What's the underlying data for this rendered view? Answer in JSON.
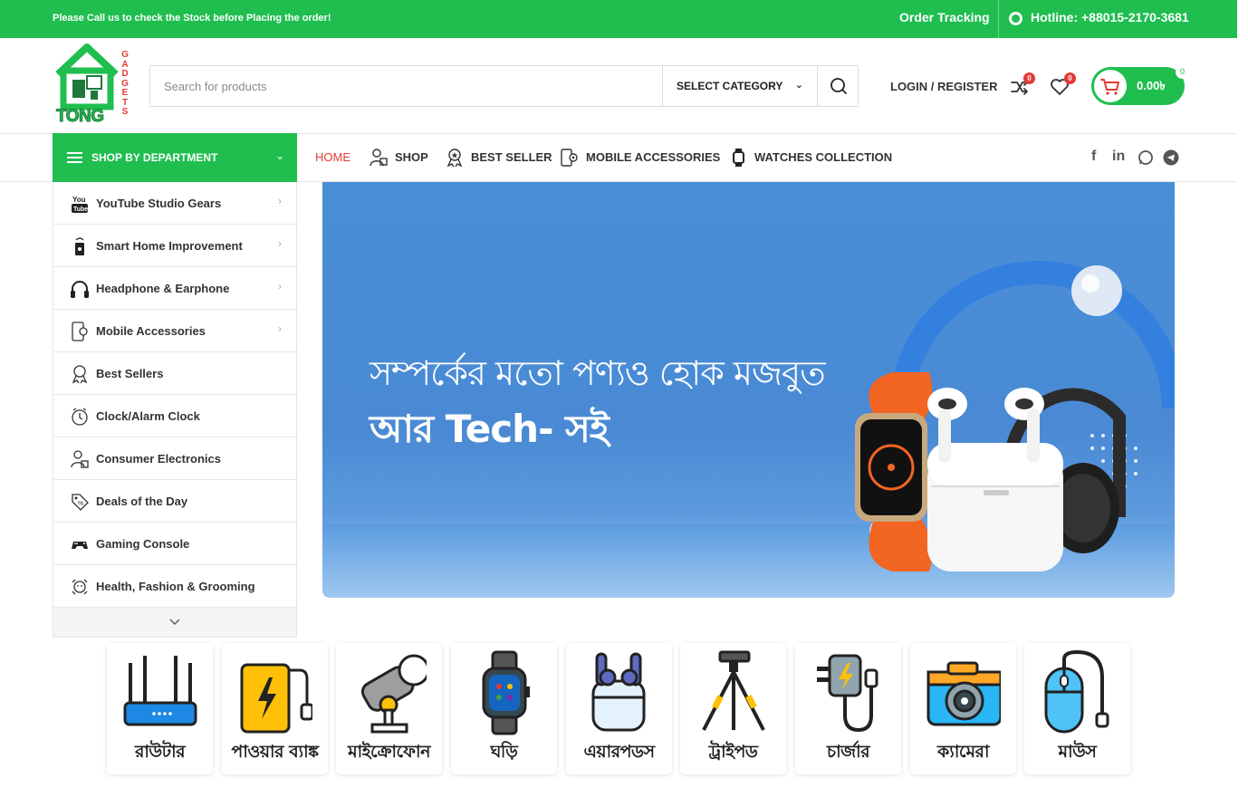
{
  "topbar": {
    "notice": "Please Call us to check the Stock before Placing the order!",
    "order_tracking": "Order Tracking",
    "hotline": "Hotline: +88015-2170-3681"
  },
  "logo": {
    "word": "TONG",
    "side_text": "GADGETS"
  },
  "search": {
    "placeholder": "Search for products",
    "category_label": "SELECT CATEGORY"
  },
  "header": {
    "login_register": "LOGIN / REGISTER",
    "compare_count": "0",
    "wishlist_count": "0",
    "cart_amount": "0.00৳",
    "cart_count": "0"
  },
  "department": {
    "label": "SHOP BY DEPARTMENT"
  },
  "nav": {
    "items": [
      {
        "label": "HOME",
        "icon": "none"
      },
      {
        "label": "SHOP",
        "icon": "shop-person-icon"
      },
      {
        "label": "BEST SELLER",
        "icon": "award-icon"
      },
      {
        "label": "MOBILE ACCESSORIES",
        "icon": "phone-accessory-icon"
      },
      {
        "label": "WATCHES COLLECTION",
        "icon": "watch-icon"
      }
    ]
  },
  "social": {
    "icons": [
      "facebook-icon",
      "linkedin-icon",
      "whatsapp-icon",
      "telegram-icon"
    ],
    "facebook": "f",
    "linkedin": "in"
  },
  "sidebar": {
    "items": [
      {
        "label": "YouTube Studio Gears",
        "icon": "youtube-icon",
        "has_submenu": true
      },
      {
        "label": "Smart Home Improvement",
        "icon": "smart-home-icon",
        "has_submenu": true
      },
      {
        "label": "Headphone & Earphone",
        "icon": "headphone-icon",
        "has_submenu": true
      },
      {
        "label": "Mobile Accessories",
        "icon": "mobile-icon",
        "has_submenu": true
      },
      {
        "label": "Best Sellers",
        "icon": "award-icon",
        "has_submenu": false
      },
      {
        "label": "Clock/Alarm Clock",
        "icon": "clock-icon",
        "has_submenu": false
      },
      {
        "label": "Consumer Electronics",
        "icon": "electronics-icon",
        "has_submenu": false
      },
      {
        "label": "Deals of the Day",
        "icon": "deal-tag-icon",
        "has_submenu": false
      },
      {
        "label": "Gaming Console",
        "icon": "gamepad-icon",
        "has_submenu": false
      },
      {
        "label": "Health, Fashion & Grooming",
        "icon": "grooming-icon",
        "has_submenu": false
      }
    ]
  },
  "hero": {
    "line1": "সম্পর্কের মতো পণ্যও হোক মজবুত",
    "line2": "আর Tech- সই"
  },
  "categories": [
    {
      "label": "রাউটার",
      "icon": "router-icon"
    },
    {
      "label": "পাওয়ার ব্যাঙ্ক",
      "icon": "power-bank-icon"
    },
    {
      "label": "মাইক্রোফোন",
      "icon": "microphone-icon"
    },
    {
      "label": "ঘড়ি",
      "icon": "smartwatch-icon"
    },
    {
      "label": "এয়ারপডস",
      "icon": "airpods-icon"
    },
    {
      "label": "ট্রাইপড",
      "icon": "tripod-icon"
    },
    {
      "label": "চার্জার",
      "icon": "charger-icon"
    },
    {
      "label": "ক্যামেরা",
      "icon": "camera-icon"
    },
    {
      "label": "মাউস",
      "icon": "mouse-icon"
    }
  ],
  "colors": {
    "brand_green": "#1fbe4f",
    "accent_red": "#e53935",
    "hero_blue": "#4a8ed8"
  }
}
